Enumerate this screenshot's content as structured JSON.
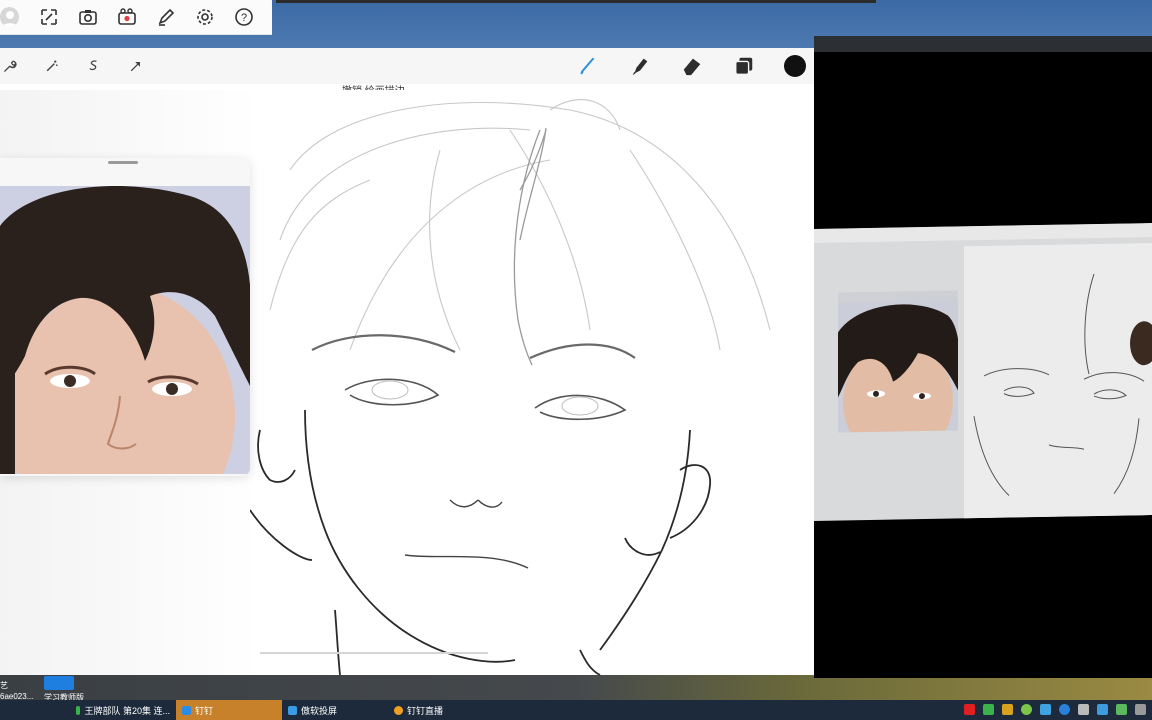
{
  "procreate": {
    "undo_hint": "撤销 绘画描边",
    "tools_left": [
      "wrench-icon",
      "magic-wand-icon",
      "selection-icon",
      "transform-icon"
    ],
    "tools_right": [
      "brush-icon",
      "smudge-icon",
      "eraser-icon",
      "layers-icon",
      "color-swatch-icon"
    ],
    "active_tool": "brush-icon",
    "current_color": "#111111"
  },
  "desktop": {
    "icons": [
      {
        "label": "艺"
      },
      {
        "label": "6ae023..."
      },
      {
        "label": "学习教师版"
      }
    ]
  },
  "taskbar": {
    "items": [
      {
        "label": "王牌部队 第20集 连..."
      },
      {
        "label": "钉钉"
      },
      {
        "label": "傲软投屏"
      },
      {
        "label": "钉钉直播"
      }
    ]
  },
  "top_toolbar": {
    "icons": [
      "avatar-icon",
      "fullscreen-icon",
      "camera-icon",
      "record-icon",
      "pen-icon",
      "gear-icon",
      "help-icon"
    ]
  },
  "colors": {
    "accent_brush": "#2a8fe0",
    "taskbar_bg": "#1c2a3b",
    "active_task": "#c7812a"
  }
}
